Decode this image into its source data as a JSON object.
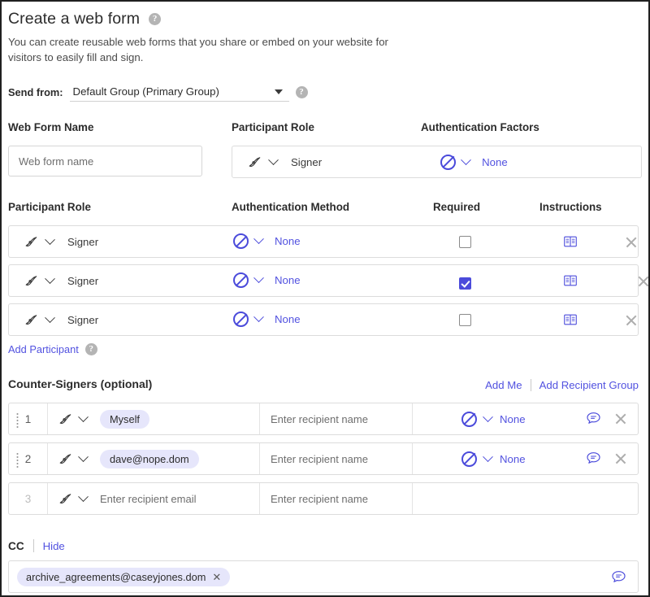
{
  "header": {
    "title": "Create a web form",
    "help_icon": "help-circle-icon",
    "subtitle": "You can create reusable web forms that you share or embed on your website for visitors to easily fill and sign."
  },
  "send_from": {
    "label": "Send from:",
    "value": "Default Group (Primary Group)",
    "help_icon": "help-circle-icon"
  },
  "top_form": {
    "headers": {
      "web_form_name": "Web Form Name",
      "participant_role": "Participant Role",
      "authentication_factors": "Authentication Factors"
    },
    "web_form_name_placeholder": "Web form name",
    "web_form_name_value": "",
    "role": "Signer",
    "auth_factor": "None"
  },
  "participants": {
    "headers": {
      "role": "Participant Role",
      "auth_method": "Authentication Method",
      "required": "Required",
      "instructions": "Instructions"
    },
    "rows": [
      {
        "role": "Signer",
        "auth_method": "None",
        "required": false,
        "instructions_icon": "book-icon",
        "remove_icon": "close-icon"
      },
      {
        "role": "Signer",
        "auth_method": "None",
        "required": true,
        "instructions_icon": "book-icon",
        "remove_icon": "close-icon"
      },
      {
        "role": "Signer",
        "auth_method": "None",
        "required": false,
        "instructions_icon": "book-icon",
        "remove_icon": "close-icon"
      }
    ],
    "add_participant_label": "Add Participant",
    "add_participant_help_icon": "help-circle-icon"
  },
  "counter_signers": {
    "title": "Counter-Signers (optional)",
    "add_me_label": "Add Me",
    "add_recipient_group_label": "Add Recipient Group",
    "name_placeholder": "Enter recipient name",
    "email_placeholder": "Enter recipient email",
    "rows": [
      {
        "index": "1",
        "email_chip": "Myself",
        "email_is_chip": true,
        "name": "Enter recipient name",
        "auth_method": "None",
        "has_auth": true,
        "has_drag": true,
        "dim": false
      },
      {
        "index": "2",
        "email_chip": "dave@nope.dom",
        "email_is_chip": true,
        "name": "Enter recipient name",
        "auth_method": "None",
        "has_auth": true,
        "has_drag": true,
        "dim": false
      },
      {
        "index": "3",
        "email_chip": "Enter recipient email",
        "email_is_chip": false,
        "name": "Enter recipient name",
        "auth_method": "",
        "has_auth": false,
        "has_drag": false,
        "dim": true
      }
    ]
  },
  "cc": {
    "label": "CC",
    "hide_label": "Hide",
    "chip": "archive_agreements@caseyjones.dom",
    "chip_remove": "✕",
    "bubble_icon": "message-bubble-icon"
  },
  "colors": {
    "accent": "#5252e0",
    "icon_blue": "#4b4bdb",
    "chip_bg": "#e6e6fb",
    "border": "#dcdcdc",
    "text": "#2c2c2c",
    "muted": "#6e6e6e"
  }
}
